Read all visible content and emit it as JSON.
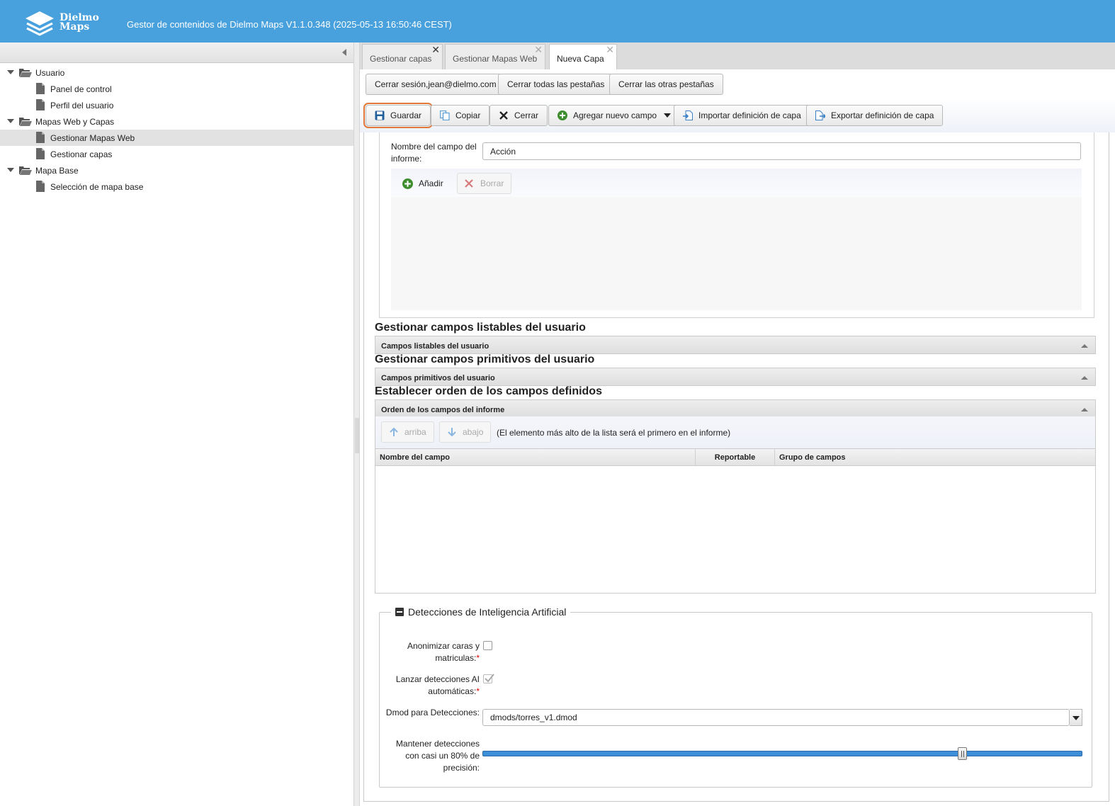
{
  "header": {
    "logo_line1": "Dielmo",
    "logo_line2": "Maps",
    "title": "Gestor de contenidos de Dielmo Maps V1.1.0.348 (2025-05-13 16:50:46 CEST)"
  },
  "sidebar": {
    "groups": [
      {
        "label": "Usuario",
        "items": [
          {
            "label": "Panel de control"
          },
          {
            "label": "Perfil del usuario"
          }
        ]
      },
      {
        "label": "Mapas Web y Capas",
        "items": [
          {
            "label": "Gestionar Mapas Web",
            "selected": true
          },
          {
            "label": "Gestionar capas"
          }
        ]
      },
      {
        "label": "Mapa Base",
        "items": [
          {
            "label": "Selección de mapa base"
          }
        ]
      }
    ]
  },
  "tabs": [
    {
      "label": "Gestionar capas",
      "close": "✕"
    },
    {
      "label": "Gestionar Mapas Web",
      "close": "✕"
    },
    {
      "label": "Nueva Capa",
      "close": "✕",
      "active": true
    }
  ],
  "session_toolbar": {
    "logout": "Cerrar sesión,jean@dielmo.com",
    "close_all": "Cerrar todas las pestañas",
    "close_others": "Cerrar las otras pestañas"
  },
  "layer_toolbar": {
    "save": "Guardar",
    "copy": "Copiar",
    "close": "Cerrar",
    "add_field": "Agregar nuevo campo",
    "import": "Importar definición de capa",
    "export": "Exportar definición de capa"
  },
  "report_field": {
    "label": "Nombre del campo del informe:",
    "value": "Acción",
    "add": "Añadir",
    "delete": "Borrar"
  },
  "sections": {
    "listable_title": "Gestionar campos listables del usuario",
    "listable_panel": "Campos listables del usuario",
    "primitive_title": "Gestionar campos primitivos del usuario",
    "primitive_panel": "Campos primitivos del usuario",
    "order_title": "Establecer orden de los campos definidos",
    "order_panel": "Orden de los campos del informe"
  },
  "order": {
    "up": "arriba",
    "down": "abajo",
    "hint": "(El elemento más alto de la lista será el primero en el informe)",
    "columns": [
      "Nombre del campo",
      "Reportable",
      "Grupo de campos"
    ]
  },
  "ai": {
    "legend": "Detecciones de Inteligencia Artificial",
    "anonymize_label": "Anonimizar caras y matriculas:",
    "anonymize_checked": false,
    "auto_label": "Lanzar detecciones AI automáticas:",
    "auto_checked": true,
    "dmod_label": "Dmod para Detecciones:",
    "dmod_value": "dmods/torres_v1.dmod",
    "keep_label": "Mantener detecciones con casi un 80% de precisión:",
    "slider_value": 80,
    "required_mark": "*"
  },
  "colors": {
    "header_bg": "#48a0dc",
    "accent_focus": "#e0783a",
    "slider": "#3c8ed8",
    "required": "#dd0000"
  }
}
